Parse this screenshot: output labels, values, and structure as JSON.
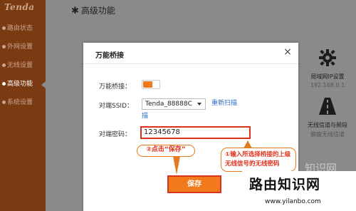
{
  "brand": "Tenda",
  "sidebar": {
    "items": [
      {
        "label": "路由状态"
      },
      {
        "label": "外网设置"
      },
      {
        "label": "无线设置"
      },
      {
        "label": "高级功能"
      },
      {
        "label": "系统设置"
      }
    ]
  },
  "main": {
    "title": "高级功能"
  },
  "tiles": [
    {
      "label": "局域网IP设置",
      "sub": "192.168.0.1"
    },
    {
      "label": "无线信道与频段",
      "sub": "偏瘦无线信道"
    }
  ],
  "dialog": {
    "title": "万能桥接",
    "close_glyph": "×",
    "bridge_label": "万能桥接：",
    "ssid_label": "对端SSID：",
    "ssid_value": "Tenda_88888C",
    "rescan_label": "重新扫描",
    "rescan_tail": "描",
    "pwd_label": "对端密码：",
    "pwd_value": "12345678",
    "annotation_1": "①输入所选择桥接的上级无线信号的无线密码",
    "annotation_2": "②点击“保存”",
    "save_label": "保存"
  },
  "watermark": {
    "main": "路由知识网",
    "sub": "www.yilanbo.com"
  },
  "ghost_text": "知识网",
  "colors": {
    "accent": "#f07a1c",
    "annotation_red": "#d9321f",
    "sidebar": "#7a3a12",
    "link": "#2b6fc4"
  }
}
